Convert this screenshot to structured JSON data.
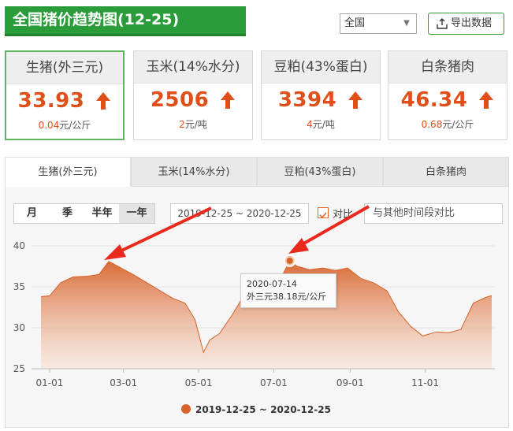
{
  "header": {
    "title": "全国猪价趋势图(12-25)",
    "region_select": "全国",
    "export_label": "导出数据"
  },
  "cards": [
    {
      "name": "生猪(外三元)",
      "value": "33.93",
      "change": "0.04",
      "unit": "元/公斤",
      "active": true
    },
    {
      "name": "玉米(14%水分)",
      "value": "2506",
      "change": "2",
      "unit": "元/吨",
      "active": false
    },
    {
      "name": "豆粕(43%蛋白)",
      "value": "3394",
      "change": "4",
      "unit": "元/吨",
      "active": false
    },
    {
      "name": "白条猪肉",
      "value": "46.34",
      "change": "0.68",
      "unit": "元/公斤",
      "active": false
    }
  ],
  "tabs": [
    "生猪(外三元)",
    "玉米(14%水分)",
    "豆粕(43%蛋白)",
    "白条猪肉"
  ],
  "controls": {
    "ranges": [
      "月",
      "季",
      "半年",
      "一年"
    ],
    "active_range": "一年",
    "date_range": "2019-12-25 ~ 2020-12-25",
    "compare_label": "对比",
    "compare_placeholder": "与其他时间段对比"
  },
  "tooltip": {
    "date": "2020-07-14",
    "text": "外三元38.18元/公斤"
  },
  "colors": {
    "accent": "#d8622a",
    "brand_green": "#2a9d3a",
    "up_arrow": "#e04f1a",
    "annotation_arrow": "#e8291c"
  },
  "chart_data": {
    "type": "area",
    "series": [
      {
        "name": "2019-12-25 ~ 2020-12-25"
      }
    ],
    "x": [
      "2019-12-25",
      "2020-01-01",
      "2020-01-10",
      "2020-01-20",
      "2020-02-01",
      "2020-02-10",
      "2020-02-18",
      "2020-02-28",
      "2020-03-10",
      "2020-03-20",
      "2020-04-01",
      "2020-04-10",
      "2020-04-20",
      "2020-04-28",
      "2020-05-05",
      "2020-05-10",
      "2020-05-18",
      "2020-05-28",
      "2020-06-05",
      "2020-06-15",
      "2020-06-25",
      "2020-07-05",
      "2020-07-14",
      "2020-07-20",
      "2020-07-30",
      "2020-08-10",
      "2020-08-20",
      "2020-08-30",
      "2020-09-10",
      "2020-09-20",
      "2020-10-01",
      "2020-10-10",
      "2020-10-20",
      "2020-10-30",
      "2020-11-10",
      "2020-11-20",
      "2020-11-30",
      "2020-12-10",
      "2020-12-20",
      "2020-12-25"
    ],
    "values": [
      33.8,
      33.9,
      35.5,
      36.2,
      36.3,
      36.5,
      38.1,
      37.3,
      36.4,
      35.5,
      34.4,
      33.6,
      33.0,
      31.0,
      27.0,
      28.5,
      29.3,
      31.5,
      33.5,
      34.2,
      34.3,
      35.5,
      38.18,
      37.5,
      37.1,
      37.3,
      37.0,
      37.3,
      36.0,
      35.5,
      34.5,
      32.0,
      30.2,
      29.0,
      29.5,
      29.4,
      29.8,
      33.0,
      33.7,
      33.93
    ],
    "xticks": [
      "01-01",
      "03-01",
      "05-01",
      "07-01",
      "09-01",
      "11-01"
    ],
    "yticks": [
      25,
      30,
      35,
      40
    ],
    "ylim": [
      25,
      40
    ],
    "legend": "bottom"
  }
}
